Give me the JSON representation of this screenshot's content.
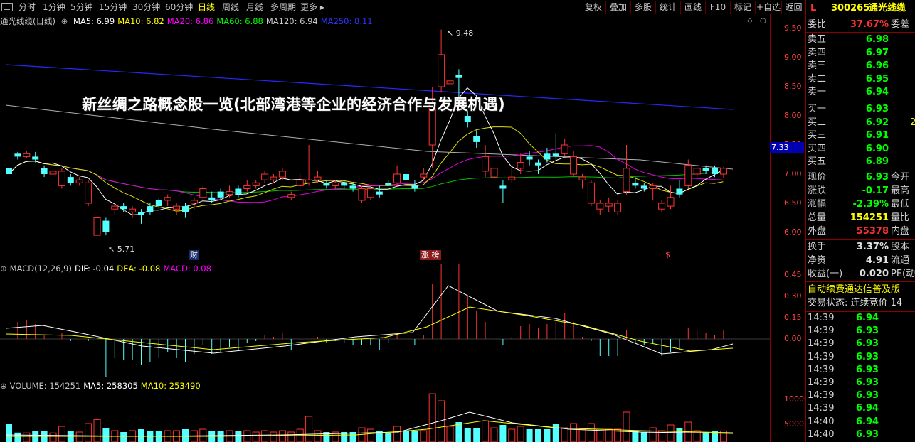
{
  "toolbar": {
    "periods": [
      {
        "label": "分时",
        "active": false
      },
      {
        "label": "1分钟",
        "active": false
      },
      {
        "label": "5分钟",
        "active": false
      },
      {
        "label": "15分钟",
        "active": false
      },
      {
        "label": "30分钟",
        "active": false
      },
      {
        "label": "60分钟",
        "active": false
      },
      {
        "label": "日线",
        "active": true
      },
      {
        "label": "周线",
        "active": false
      },
      {
        "label": "月线",
        "active": false
      },
      {
        "label": "多周期",
        "active": false
      },
      {
        "label": "更多 ▸",
        "active": false
      }
    ],
    "buttons": [
      "复权",
      "叠加",
      "多股",
      "统计",
      "画线",
      "F10",
      "标记",
      "+自选",
      "返回"
    ]
  },
  "price_panel": {
    "stock_label": "通光线缆(日线)",
    "ma": [
      {
        "label": "MA5: 6.99",
        "color": "#ffffff"
      },
      {
        "label": "MA10: 6.82",
        "color": "#ffff00"
      },
      {
        "label": "MA20: 6.86",
        "color": "#ff00ff"
      },
      {
        "label": "MA60: 6.88",
        "color": "#00ff00"
      },
      {
        "label": "MA120: 6.94",
        "color": "#c8c8c8"
      },
      {
        "label": "MA250: 8.11",
        "color": "#3030ff"
      }
    ],
    "axis_labels": [
      "9.50",
      "9.00",
      "8.50",
      "8.00",
      "7.50",
      "7.00",
      "6.50",
      "6.00"
    ],
    "current_price_tag": "7.33",
    "high_marker": "9.48",
    "low_marker": "5.71",
    "event_tags": [
      "财",
      "涨 榜",
      "$"
    ]
  },
  "overlay_title": "新丝绸之路概念股一览(北部湾港等企业的经济合作与发展机遇)",
  "macd_panel": {
    "header": [
      {
        "label": "MACD(12,26,9)",
        "color": "#c8c8c8"
      },
      {
        "label": "DIF: -0.04",
        "color": "#ffffff"
      },
      {
        "label": "DEA: -0.08",
        "color": "#ffff00"
      },
      {
        "label": "MACD: 0.08",
        "color": "#ff00ff"
      }
    ],
    "axis_labels": [
      "0.45",
      "0.30",
      "0.15",
      "0.00"
    ]
  },
  "volume_panel": {
    "header": [
      {
        "label": "VOLUME: 154251",
        "color": "#c8c8c8"
      },
      {
        "label": "MA5: 258305",
        "color": "#ffffff"
      },
      {
        "label": "MA10: 253490",
        "color": "#ffff00"
      }
    ],
    "axis_labels": [
      "10000",
      "5000"
    ]
  },
  "sidebar": {
    "header": {
      "flag": "L",
      "code": "300265",
      "name": "通光线缆"
    },
    "weibi": {
      "label": "委比",
      "value": "37.67%",
      "extra": "委差"
    },
    "asks": [
      {
        "label": "卖五",
        "price": "6.98"
      },
      {
        "label": "卖四",
        "price": "6.97"
      },
      {
        "label": "卖三",
        "price": "6.96"
      },
      {
        "label": "卖二",
        "price": "6.95"
      },
      {
        "label": "卖一",
        "price": "6.94"
      }
    ],
    "bids": [
      {
        "label": "买一",
        "price": "6.93"
      },
      {
        "label": "买二",
        "price": "6.92",
        "extra": "2"
      },
      {
        "label": "买三",
        "price": "6.91"
      },
      {
        "label": "买四",
        "price": "6.90"
      },
      {
        "label": "买五",
        "price": "6.89"
      }
    ],
    "quote": [
      {
        "label": "现价",
        "value": "6.93",
        "extra": "今开",
        "color": "#00ff00"
      },
      {
        "label": "涨跌",
        "value": "-0.17",
        "extra": "最高",
        "color": "#00ff00"
      },
      {
        "label": "涨幅",
        "value": "-2.39%",
        "extra": "最低",
        "color": "#00ff00"
      },
      {
        "label": "总量",
        "value": "154251",
        "extra": "量比",
        "color": "#ffff00"
      },
      {
        "label": "外盘",
        "value": "55378",
        "extra": "内盘",
        "color": "#ff3030"
      }
    ],
    "stats": [
      {
        "label": "换手",
        "value": "3.37%",
        "extra": "股本",
        "color": "#e0e0e0"
      },
      {
        "label": "净资",
        "value": "4.91",
        "extra": "流通",
        "color": "#e0e0e0"
      },
      {
        "label": "收益(一)",
        "value": "0.020",
        "extra": "PE(动",
        "color": "#e0e0e0"
      }
    ],
    "ticker": "自动续费通达信普及版",
    "trade_status": "交易状态: 连续竞价 14",
    "trades": [
      {
        "time": "14:39",
        "price": "6.94"
      },
      {
        "time": "14:39",
        "price": "6.93"
      },
      {
        "time": "14:39",
        "price": "6.93"
      },
      {
        "time": "14:39",
        "price": "6.93"
      },
      {
        "time": "14:39",
        "price": "6.93"
      },
      {
        "time": "14:39",
        "price": "6.93"
      },
      {
        "time": "14:39",
        "price": "6.93"
      },
      {
        "time": "14:39",
        "price": "6.94"
      },
      {
        "time": "14:40",
        "price": "6.94"
      },
      {
        "time": "14:40",
        "price": "6.93"
      }
    ]
  },
  "chart_data": {
    "type": "candlestick",
    "series_ohlc": [
      [
        7.1,
        7.0,
        7.4,
        6.95
      ],
      [
        7.35,
        7.3,
        7.38,
        7.25
      ],
      [
        7.3,
        7.35,
        7.4,
        7.28
      ],
      [
        7.3,
        7.25,
        7.38,
        7.2
      ],
      [
        7.1,
        7.0,
        7.15,
        6.95
      ],
      [
        7.0,
        7.05,
        7.1,
        6.98
      ],
      [
        6.8,
        7.05,
        7.1,
        6.75
      ],
      [
        6.95,
        6.85,
        7.0,
        6.8
      ],
      [
        6.85,
        6.9,
        6.95,
        6.8
      ],
      [
        6.5,
        6.85,
        6.9,
        6.45
      ],
      [
        5.95,
        6.25,
        6.3,
        5.71
      ],
      [
        6.2,
        6.0,
        6.25,
        5.95
      ],
      [
        6.4,
        6.45,
        6.5,
        6.3
      ],
      [
        6.45,
        6.4,
        6.5,
        6.35
      ],
      [
        6.35,
        6.4,
        6.45,
        6.25
      ],
      [
        6.35,
        6.3,
        6.4,
        6.15
      ],
      [
        6.45,
        6.35,
        6.5,
        6.3
      ],
      [
        6.55,
        6.45,
        6.6,
        6.4
      ],
      [
        6.55,
        6.6,
        6.65,
        6.45
      ],
      [
        6.4,
        6.45,
        6.5,
        6.3
      ],
      [
        6.45,
        6.35,
        6.5,
        6.25
      ],
      [
        6.5,
        6.55,
        6.6,
        6.4
      ],
      [
        6.6,
        6.75,
        6.8,
        6.55
      ],
      [
        6.6,
        6.55,
        6.7,
        6.5
      ],
      [
        6.7,
        6.6,
        6.75,
        6.55
      ],
      [
        6.65,
        6.7,
        6.8,
        6.6
      ],
      [
        6.75,
        6.65,
        6.8,
        6.6
      ],
      [
        6.75,
        6.8,
        6.9,
        6.7
      ],
      [
        6.8,
        6.85,
        6.9,
        6.75
      ],
      [
        6.9,
        7.0,
        7.05,
        6.85
      ],
      [
        6.9,
        6.95,
        7.0,
        6.85
      ],
      [
        6.95,
        7.05,
        7.1,
        6.9
      ],
      [
        6.6,
        6.65,
        6.7,
        6.55
      ],
      [
        6.8,
        6.9,
        7.0,
        6.75
      ],
      [
        6.85,
        6.9,
        7.5,
        6.8
      ],
      [
        6.9,
        6.95,
        7.05,
        6.85
      ],
      [
        6.85,
        6.8,
        6.9,
        6.75
      ],
      [
        6.8,
        6.85,
        6.9,
        6.75
      ],
      [
        6.85,
        6.8,
        6.9,
        6.75
      ],
      [
        6.8,
        6.75,
        6.85,
        6.7
      ],
      [
        6.55,
        6.75,
        6.8,
        6.5
      ],
      [
        6.6,
        6.75,
        6.8,
        6.55
      ],
      [
        6.7,
        6.65,
        6.8,
        6.6
      ],
      [
        6.85,
        6.8,
        6.9,
        6.8
      ],
      [
        6.85,
        7.0,
        7.15,
        6.8
      ],
      [
        7.0,
        6.9,
        7.05,
        6.85
      ],
      [
        6.8,
        6.75,
        6.9,
        6.7
      ],
      [
        6.95,
        7.0,
        7.1,
        6.9
      ],
      [
        7.5,
        8.2,
        8.5,
        7.1
      ],
      [
        8.5,
        9.05,
        9.48,
        8.4
      ],
      [
        8.55,
        8.6,
        8.8,
        8.45
      ],
      [
        8.7,
        8.65,
        8.8,
        8.3
      ],
      [
        8.0,
        7.9,
        8.1,
        7.8
      ],
      [
        7.65,
        7.55,
        7.75,
        7.45
      ],
      [
        7.05,
        7.3,
        7.5,
        6.95
      ],
      [
        6.95,
        7.1,
        7.2,
        6.9
      ],
      [
        6.8,
        6.75,
        6.9,
        6.5
      ],
      [
        6.9,
        6.95,
        7.1,
        6.85
      ],
      [
        7.1,
        7.2,
        7.35,
        7.0
      ],
      [
        7.3,
        7.25,
        7.4,
        7.15
      ],
      [
        7.2,
        7.15,
        7.25,
        7.0
      ],
      [
        7.35,
        7.25,
        7.45,
        7.2
      ],
      [
        7.35,
        7.3,
        7.7,
        7.25
      ],
      [
        7.35,
        7.5,
        7.6,
        7.3
      ],
      [
        7.0,
        7.3,
        7.4,
        6.95
      ],
      [
        6.9,
        6.95,
        7.0,
        6.75
      ],
      [
        6.5,
        6.85,
        6.9,
        6.45
      ],
      [
        6.4,
        6.5,
        6.55,
        6.3
      ],
      [
        6.45,
        6.5,
        6.6,
        6.35
      ],
      [
        6.35,
        6.5,
        6.55,
        6.3
      ],
      [
        6.7,
        7.1,
        7.5,
        6.65
      ],
      [
        6.85,
        6.8,
        6.95,
        6.75
      ],
      [
        6.8,
        6.75,
        6.85,
        6.7
      ],
      [
        6.75,
        6.8,
        6.85,
        6.55
      ],
      [
        6.4,
        6.5,
        6.55,
        6.35
      ],
      [
        6.45,
        6.6,
        6.8,
        6.4
      ],
      [
        6.75,
        6.65,
        6.9,
        6.6
      ],
      [
        6.8,
        7.15,
        7.25,
        6.75
      ],
      [
        7.0,
        7.1,
        7.15,
        6.95
      ],
      [
        7.1,
        7.05,
        7.15,
        7.0
      ],
      [
        7.1,
        7.0,
        7.15,
        6.95
      ],
      [
        7.0,
        7.1,
        7.12,
        6.93
      ]
    ]
  }
}
